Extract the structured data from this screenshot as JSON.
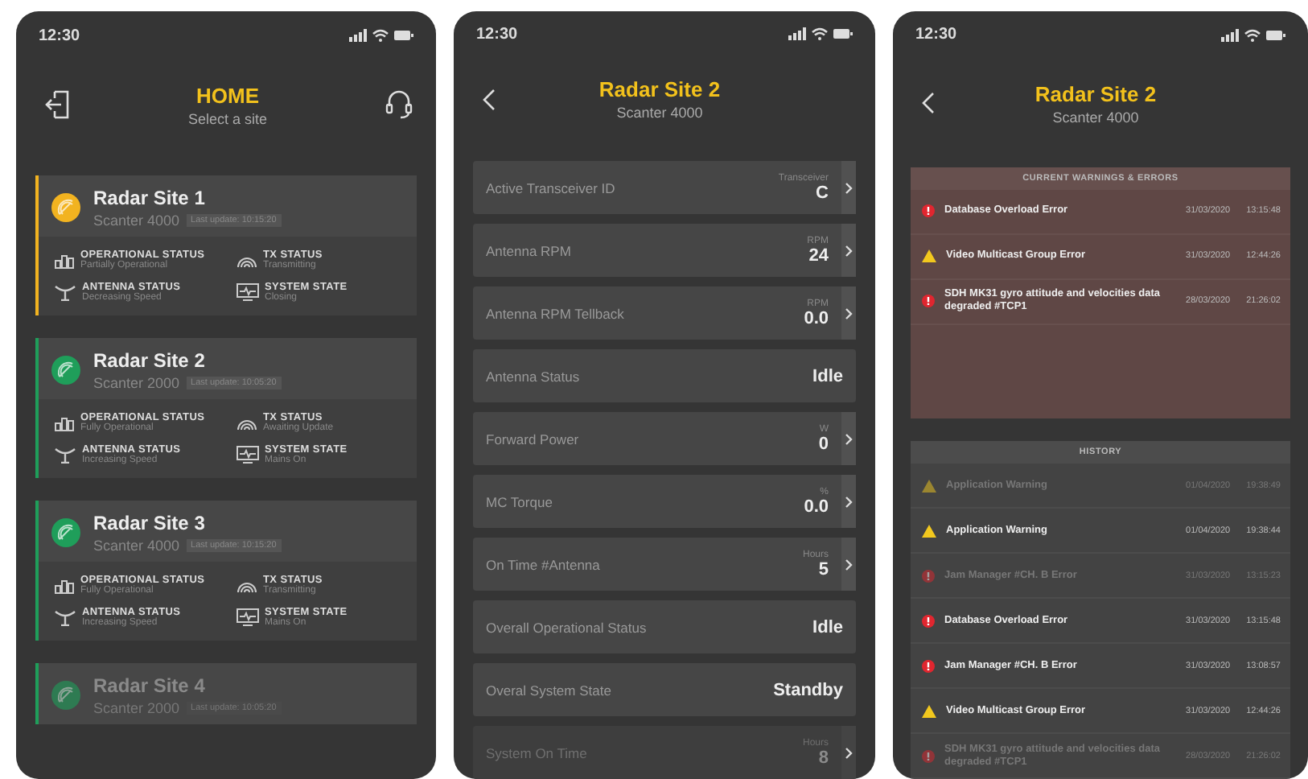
{
  "home": {
    "time": "12:30",
    "title": "HOME",
    "subtitle": "Select a site",
    "sites": [
      {
        "name": "Radar Site 1",
        "model": "Scanter 4000",
        "last_update": "Last update: 10:15:20",
        "color": "#f2b320",
        "dimmed": false,
        "statuses": [
          {
            "kind": "operational",
            "label": "OPERATIONAL STATUS",
            "value": "Partially Operational"
          },
          {
            "kind": "tx",
            "label": "TX STATUS",
            "value": "Transmitting"
          },
          {
            "kind": "antenna",
            "label": "ANTENNA STATUS",
            "value": "Decreasing Speed"
          },
          {
            "kind": "system",
            "label": "SYSTEM STATE",
            "value": "Closing"
          }
        ]
      },
      {
        "name": "Radar Site 2",
        "model": "Scanter 2000",
        "last_update": "Last update: 10:05:20",
        "color": "#1f9e5a",
        "dimmed": false,
        "statuses": [
          {
            "kind": "operational",
            "label": "OPERATIONAL STATUS",
            "value": "Fully Operational"
          },
          {
            "kind": "tx",
            "label": "TX STATUS",
            "value": "Awaiting Update"
          },
          {
            "kind": "antenna",
            "label": "ANTENNA STATUS",
            "value": "Increasing Speed"
          },
          {
            "kind": "system",
            "label": "SYSTEM STATE",
            "value": "Mains On"
          }
        ]
      },
      {
        "name": "Radar Site 3",
        "model": "Scanter 4000",
        "last_update": "Last update: 10:15:20",
        "color": "#1f9e5a",
        "dimmed": false,
        "statuses": [
          {
            "kind": "operational",
            "label": "OPERATIONAL STATUS",
            "value": "Fully Operational"
          },
          {
            "kind": "tx",
            "label": "TX STATUS",
            "value": "Transmitting"
          },
          {
            "kind": "antenna",
            "label": "ANTENNA STATUS",
            "value": "Increasing Speed"
          },
          {
            "kind": "system",
            "label": "SYSTEM STATE",
            "value": "Mains On"
          }
        ]
      },
      {
        "name": "Radar Site 4",
        "model": "Scanter 2000",
        "last_update": "Last update: 10:05:20",
        "color": "#1f9e5a",
        "dimmed": true
      }
    ]
  },
  "detail": {
    "time": "12:30",
    "title": "Radar Site 2",
    "subtitle": "Scanter 4000",
    "rows": [
      {
        "label": "Active Transceiver ID",
        "unit": "Transceiver",
        "value": "C",
        "chevron": true,
        "dimmed": false
      },
      {
        "label": "Antenna RPM",
        "unit": "RPM",
        "value": "24",
        "chevron": true,
        "dimmed": false
      },
      {
        "label": "Antenna RPM Tellback",
        "unit": "RPM",
        "value": "0.0",
        "chevron": true,
        "dimmed": false
      },
      {
        "label": "Antenna Status",
        "value": "Idle",
        "chevron": false,
        "dimmed": false
      },
      {
        "label": "Forward Power",
        "unit": "W",
        "value": "0",
        "chevron": true,
        "dimmed": false
      },
      {
        "label": "MC Torque",
        "unit": "%",
        "value": "0.0",
        "chevron": true,
        "dimmed": false
      },
      {
        "label": "On Time #Antenna",
        "unit": "Hours",
        "value": "5",
        "chevron": true,
        "dimmed": false
      },
      {
        "label": "Overall Operational Status",
        "value": "Idle",
        "chevron": false,
        "dimmed": false
      },
      {
        "label": "Overal System State",
        "value": "Standby",
        "chevron": false,
        "dimmed": false
      },
      {
        "label": "System On Time",
        "unit": "Hours",
        "value": "8",
        "chevron": true,
        "dimmed": true
      }
    ]
  },
  "alarms": {
    "time": "12:30",
    "title": "Radar Site 2",
    "subtitle": "Scanter 4000",
    "current": {
      "heading": "CURRENT WARNINGS & ERRORS",
      "items": [
        {
          "kind": "error",
          "text": "Database Overload Error",
          "date": "31/03/2020",
          "time": "13:15:48",
          "dimmed": false
        },
        {
          "kind": "warning",
          "text": "Video Multicast Group Error",
          "date": "31/03/2020",
          "time": "12:44:26",
          "dimmed": false
        },
        {
          "kind": "error",
          "text": "SDH MK31 gyro attitude and velocities data degraded #TCP1",
          "date": "28/03/2020",
          "time": "21:26:02",
          "dimmed": false
        }
      ]
    },
    "history": {
      "heading": "HISTORY",
      "items": [
        {
          "kind": "warning",
          "text": "Application Warning",
          "date": "01/04/2020",
          "time": "19:38:49",
          "dimmed": true
        },
        {
          "kind": "warning",
          "text": "Application Warning",
          "date": "01/04/2020",
          "time": "19:38:44",
          "dimmed": false
        },
        {
          "kind": "error",
          "text": "Jam Manager #CH. B Error",
          "date": "31/03/2020",
          "time": "13:15:23",
          "dimmed": true
        },
        {
          "kind": "error",
          "text": "Database Overload Error",
          "date": "31/03/2020",
          "time": "13:15:48",
          "dimmed": false
        },
        {
          "kind": "error",
          "text": "Jam Manager #CH. B Error",
          "date": "31/03/2020",
          "time": "13:08:57",
          "dimmed": false
        },
        {
          "kind": "warning",
          "text": "Video Multicast Group Error",
          "date": "31/03/2020",
          "time": "12:44:26",
          "dimmed": false
        },
        {
          "kind": "error",
          "text": "SDH MK31 gyro attitude and velocities data degraded #TCP1",
          "date": "28/03/2020",
          "time": "21:26:02",
          "dimmed": true
        }
      ]
    }
  }
}
